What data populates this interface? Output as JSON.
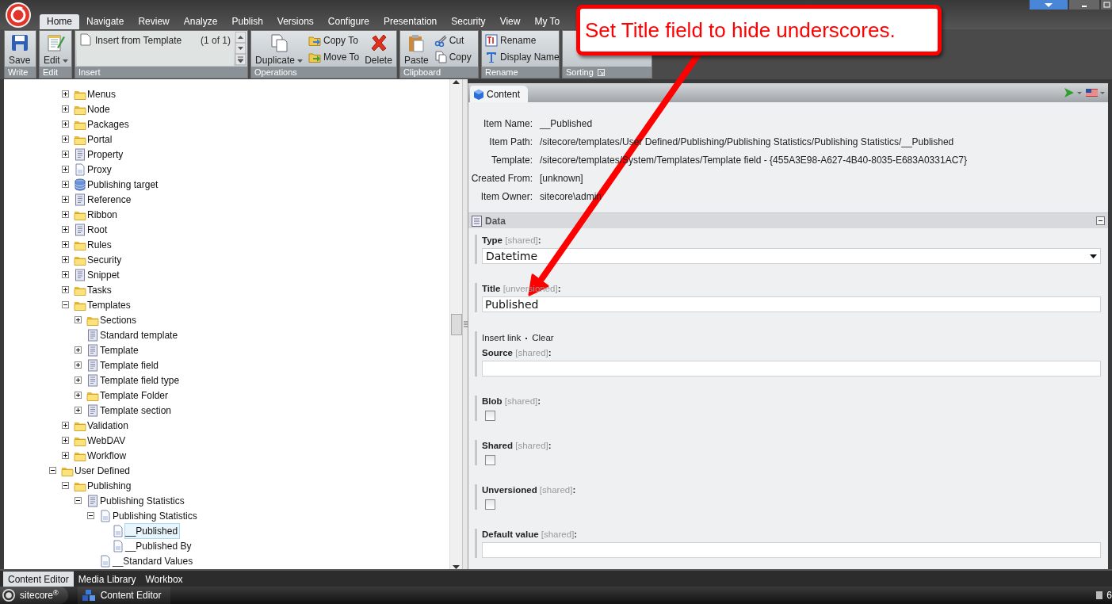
{
  "ribbon": {
    "tabs": [
      {
        "label": "Home",
        "selected": true
      },
      {
        "label": "Navigate",
        "selected": false
      },
      {
        "label": "Review",
        "selected": false
      },
      {
        "label": "Analyze",
        "selected": false
      },
      {
        "label": "Publish",
        "selected": false
      },
      {
        "label": "Versions",
        "selected": false
      },
      {
        "label": "Configure",
        "selected": false
      },
      {
        "label": "Presentation",
        "selected": false
      },
      {
        "label": "Security",
        "selected": false
      },
      {
        "label": "View",
        "selected": false
      },
      {
        "label": "My To",
        "selected": false
      }
    ],
    "groups": [
      {
        "label": "Write",
        "buttons": [
          {
            "label": "Save",
            "kind": "large"
          }
        ]
      },
      {
        "label": "Edit",
        "buttons": [
          {
            "label": "Edit",
            "kind": "large-menu"
          }
        ]
      },
      {
        "label": "Insert",
        "gallery": {
          "items": [
            "Insert from Template"
          ],
          "counter": "(1 of 1)"
        }
      },
      {
        "label": "Operations",
        "buttons": [
          {
            "label": "Duplicate",
            "kind": "large-menu"
          },
          {
            "label": "Copy To",
            "kind": "small"
          },
          {
            "label": "Move To",
            "kind": "small"
          },
          {
            "label": "Delete",
            "kind": "large"
          }
        ]
      },
      {
        "label": "Clipboard",
        "buttons": [
          {
            "label": "Paste",
            "kind": "large"
          },
          {
            "label": "Cut",
            "kind": "small"
          },
          {
            "label": "Copy",
            "kind": "small"
          }
        ]
      },
      {
        "label": "Rename",
        "buttons": [
          {
            "label": "Rename",
            "kind": "small"
          },
          {
            "label": "Display Name",
            "kind": "small"
          }
        ]
      },
      {
        "label": "Sorting",
        "launcher": true
      }
    ]
  },
  "tree": [
    {
      "children": [
        {
          "label": "Menus",
          "kind": "folder",
          "expanded": false,
          "selected": false
        },
        {
          "label": "Node",
          "kind": "folder",
          "expanded": false,
          "selected": false
        },
        {
          "label": "Packages",
          "kind": "folder",
          "expanded": false,
          "selected": false
        },
        {
          "label": "Portal",
          "kind": "folder",
          "expanded": false,
          "selected": false
        },
        {
          "label": "Property",
          "kind": "template",
          "expanded": false,
          "selected": false
        },
        {
          "label": "Proxy",
          "kind": "item",
          "expanded": false,
          "selected": false
        },
        {
          "label": "Publishing target",
          "kind": "database",
          "expanded": false,
          "selected": false
        },
        {
          "label": "Reference",
          "kind": "template",
          "expanded": false,
          "selected": false
        },
        {
          "label": "Ribbon",
          "kind": "folder",
          "expanded": false,
          "selected": false
        },
        {
          "label": "Root",
          "kind": "template",
          "expanded": false,
          "selected": false
        },
        {
          "label": "Rules",
          "kind": "folder",
          "expanded": false,
          "selected": false
        },
        {
          "label": "Security",
          "kind": "folder",
          "expanded": false,
          "selected": false
        },
        {
          "label": "Snippet",
          "kind": "template",
          "expanded": false,
          "selected": false
        },
        {
          "label": "Tasks",
          "kind": "folder",
          "expanded": false,
          "selected": false
        },
        {
          "label": "Templates",
          "kind": "folder",
          "expanded": true,
          "selected": false,
          "children": [
            {
              "label": "Sections",
              "kind": "folder",
              "expanded": false,
              "selected": false
            },
            {
              "label": "Standard template",
              "kind": "template",
              "selected": false
            },
            {
              "label": "Template",
              "kind": "template",
              "expanded": false,
              "selected": false
            },
            {
              "label": "Template field",
              "kind": "template",
              "expanded": false,
              "selected": false
            },
            {
              "label": "Template field type",
              "kind": "template",
              "expanded": false,
              "selected": false
            },
            {
              "label": "Template Folder",
              "kind": "folder",
              "expanded": false,
              "selected": false
            },
            {
              "label": "Template section",
              "kind": "template",
              "expanded": false,
              "selected": false
            }
          ]
        },
        {
          "label": "Validation",
          "kind": "folder",
          "expanded": false,
          "selected": false
        },
        {
          "label": "WebDAV",
          "kind": "folder",
          "expanded": false,
          "selected": false
        },
        {
          "label": "Workflow",
          "kind": "folder",
          "expanded": false,
          "selected": false
        }
      ]
    },
    {
      "label": "User Defined",
      "kind": "folder",
      "expanded": true,
      "selected": false,
      "children": [
        {
          "label": "Publishing",
          "kind": "folder",
          "expanded": true,
          "selected": false,
          "children": [
            {
              "label": "Publishing Statistics",
              "kind": "template",
              "expanded": true,
              "selected": false,
              "children": [
                {
                  "label": "Publishing Statistics",
                  "kind": "item",
                  "expanded": true,
                  "selected": false,
                  "children": [
                    {
                      "label": "__Published",
                      "kind": "item",
                      "selected": true
                    },
                    {
                      "label": "__Published By",
                      "kind": "item",
                      "selected": false
                    }
                  ]
                },
                {
                  "label": "__Standard Values",
                  "kind": "item",
                  "selected": false
                }
              ]
            }
          ]
        }
      ]
    }
  ],
  "editor": {
    "tab": {
      "label": "Content",
      "selected": true
    },
    "info": [
      {
        "label": "Item Name:",
        "value": "__Published"
      },
      {
        "label": "Item Path:",
        "value": "/sitecore/templates/User Defined/Publishing/Publishing Statistics/Publishing Statistics/__Published"
      },
      {
        "label": "Template:",
        "value": "/sitecore/templates/System/Templates/Template field - {455A3E98-A627-4B40-8035-E683A0331AC7}"
      },
      {
        "label": "Created From:",
        "value": "[unknown]"
      },
      {
        "label": "Item Owner:",
        "value": "sitecore\\admin"
      }
    ],
    "section": {
      "title": "Data",
      "expanded": true
    },
    "fields": [
      {
        "kind": "dropdown",
        "label": "**Type** [shared]**:**",
        "value": "Datetime"
      },
      {
        "kind": "text",
        "label": "**Title** [unversioned]**:**",
        "value": "Published"
      },
      {
        "kind": "text",
        "label": "**Source** [shared]**:**",
        "links": [
          "Insert link",
          "Clear"
        ]
      },
      {
        "kind": "checkbox",
        "label": "**Blob** [shared]**:**",
        "checked": false
      },
      {
        "kind": "checkbox",
        "label": "**Shared** [shared]**:**",
        "checked": false
      },
      {
        "kind": "checkbox",
        "label": "**Unversioned** [shared]**:**",
        "checked": false
      },
      {
        "kind": "text",
        "label": "**Default value** [shared]**:**"
      }
    ]
  },
  "bottom_tabs": [
    {
      "label": "Content Editor",
      "selected": true
    },
    {
      "label": "Media Library",
      "selected": false
    },
    {
      "label": "Workbox",
      "selected": false
    }
  ],
  "taskbar": {
    "start": "sitecore$^{®}$",
    "tasks": [
      {
        "label": "Content Editor",
        "selected": true
      }
    ],
    "tray": "6"
  },
  "callout": {
    "text": "Set Title field to hide underscores."
  }
}
